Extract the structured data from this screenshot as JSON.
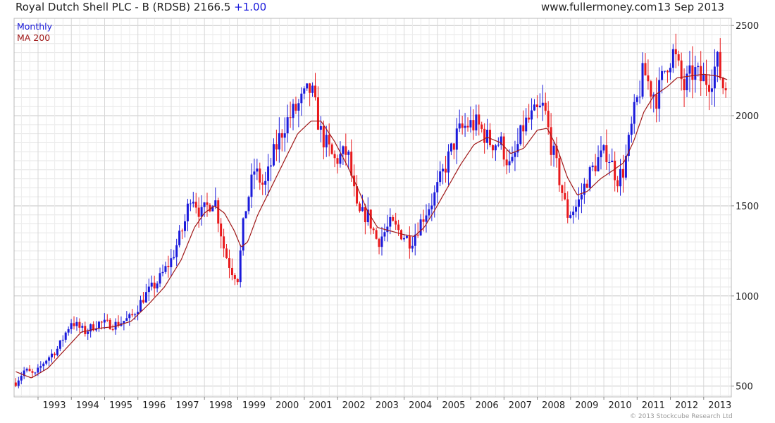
{
  "header": {
    "title": "Royal Dutch Shell PLC - B (RDSB) 2166.5",
    "change": "+1.00",
    "site": "www.fullermoney.com",
    "date": "13 Sep 2013"
  },
  "footer": {
    "copyright": "© 2013 Stockcube Research Ltd"
  },
  "colors": {
    "up": "#1a1adb",
    "down": "#e8191c",
    "ma": "#a01818",
    "grid": "#d4d4d4",
    "border": "#b9b9b9"
  },
  "chart_data": {
    "type": "candlestick",
    "legend": [
      {
        "label": "Monthly",
        "color": "#1a1adb"
      },
      {
        "label": "MA 200",
        "color": "#a01818"
      }
    ],
    "legend_position": "top-left",
    "y_axis_side": "right",
    "ylim": [
      440,
      2540
    ],
    "yticks": [
      500,
      1000,
      1500,
      2000,
      2500
    ],
    "xlim": [
      1992.28,
      2013.83
    ],
    "xticks": [
      {
        "label": "1993",
        "x": 1993.0
      },
      {
        "label": "1994",
        "x": 1994.0
      },
      {
        "label": "1995",
        "x": 1995.0
      },
      {
        "label": "1996",
        "x": 1996.0
      },
      {
        "label": "1997",
        "x": 1997.0
      },
      {
        "label": "1998",
        "x": 1998.0
      },
      {
        "label": "1999",
        "x": 1999.0
      },
      {
        "label": "2000",
        "x": 2000.0
      },
      {
        "label": "2001",
        "x": 2001.0
      },
      {
        "label": "2002",
        "x": 2002.0
      },
      {
        "label": "2003",
        "x": 2003.0
      },
      {
        "label": "2004",
        "x": 2004.0
      },
      {
        "label": "2005",
        "x": 2005.0
      },
      {
        "label": "2006",
        "x": 2006.0
      },
      {
        "label": "2007",
        "x": 2007.0
      },
      {
        "label": "2008",
        "x": 2008.0
      },
      {
        "label": "2009",
        "x": 2009.0
      },
      {
        "label": "2010",
        "x": 2010.0
      },
      {
        "label": "2011",
        "x": 2011.0
      },
      {
        "label": "2012",
        "x": 2012.0
      },
      {
        "label": "2013",
        "x": 2013.0
      }
    ],
    "grid": true,
    "price_anchors": [
      [
        1992.33,
        520
      ],
      [
        1992.6,
        590
      ],
      [
        1992.9,
        560
      ],
      [
        1993.2,
        640
      ],
      [
        1993.6,
        710
      ],
      [
        1994.0,
        860
      ],
      [
        1994.4,
        800
      ],
      [
        1994.8,
        850
      ],
      [
        1995.3,
        840
      ],
      [
        1995.8,
        880
      ],
      [
        1996.2,
        1000
      ],
      [
        1996.6,
        1080
      ],
      [
        1997.0,
        1200
      ],
      [
        1997.4,
        1400
      ],
      [
        1997.6,
        1580
      ],
      [
        1997.9,
        1450
      ],
      [
        1998.3,
        1550
      ],
      [
        1998.6,
        1250
      ],
      [
        1998.8,
        1150
      ],
      [
        1999.0,
        1100
      ],
      [
        1999.2,
        1450
      ],
      [
        1999.5,
        1700
      ],
      [
        1999.8,
        1600
      ],
      [
        2000.1,
        1800
      ],
      [
        2000.4,
        1950
      ],
      [
        2000.8,
        2050
      ],
      [
        2001.2,
        2150
      ],
      [
        2001.5,
        1900
      ],
      [
        2001.9,
        1750
      ],
      [
        2002.3,
        1800
      ],
      [
        2002.6,
        1450
      ],
      [
        2002.9,
        1450
      ],
      [
        2003.2,
        1300
      ],
      [
        2003.6,
        1400
      ],
      [
        2003.9,
        1350
      ],
      [
        2004.2,
        1300
      ],
      [
        2004.6,
        1450
      ],
      [
        2004.9,
        1550
      ],
      [
        2005.2,
        1700
      ],
      [
        2005.6,
        1900
      ],
      [
        2005.9,
        1950
      ],
      [
        2006.2,
        1950
      ],
      [
        2006.6,
        1850
      ],
      [
        2006.9,
        1850
      ],
      [
        2007.2,
        1700
      ],
      [
        2007.6,
        1950
      ],
      [
        2007.9,
        2000
      ],
      [
        2008.2,
        2050
      ],
      [
        2008.4,
        1850
      ],
      [
        2008.6,
        1700
      ],
      [
        2008.9,
        1450
      ],
      [
        2009.2,
        1500
      ],
      [
        2009.5,
        1650
      ],
      [
        2009.8,
        1750
      ],
      [
        2010.1,
        1800
      ],
      [
        2010.4,
        1650
      ],
      [
        2010.6,
        1700
      ],
      [
        2010.9,
        2000
      ],
      [
        2011.2,
        2250
      ],
      [
        2011.4,
        2150
      ],
      [
        2011.6,
        2100
      ],
      [
        2011.9,
        2300
      ],
      [
        2012.1,
        2350
      ],
      [
        2012.4,
        2150
      ],
      [
        2012.7,
        2250
      ],
      [
        2012.9,
        2200
      ],
      [
        2013.2,
        2200
      ],
      [
        2013.4,
        2300
      ],
      [
        2013.6,
        2150
      ],
      [
        2013.71,
        2166
      ]
    ],
    "ma_anchors": [
      [
        1992.33,
        580
      ],
      [
        1992.8,
        545
      ],
      [
        1993.3,
        600
      ],
      [
        1993.8,
        700
      ],
      [
        1994.3,
        800
      ],
      [
        1994.8,
        820
      ],
      [
        1995.3,
        830
      ],
      [
        1995.8,
        860
      ],
      [
        1996.3,
        950
      ],
      [
        1996.8,
        1050
      ],
      [
        1997.3,
        1200
      ],
      [
        1997.7,
        1380
      ],
      [
        1998.0,
        1460
      ],
      [
        1998.3,
        1500
      ],
      [
        1998.6,
        1460
      ],
      [
        1998.9,
        1360
      ],
      [
        1999.1,
        1270
      ],
      [
        1999.3,
        1300
      ],
      [
        1999.6,
        1450
      ],
      [
        2000.0,
        1600
      ],
      [
        2000.4,
        1750
      ],
      [
        2000.8,
        1900
      ],
      [
        2001.2,
        1970
      ],
      [
        2001.5,
        1970
      ],
      [
        2001.9,
        1860
      ],
      [
        2002.3,
        1720
      ],
      [
        2002.6,
        1600
      ],
      [
        2002.9,
        1470
      ],
      [
        2003.2,
        1380
      ],
      [
        2003.6,
        1360
      ],
      [
        2004.0,
        1340
      ],
      [
        2004.3,
        1330
      ],
      [
        2004.6,
        1380
      ],
      [
        2004.9,
        1470
      ],
      [
        2005.3,
        1600
      ],
      [
        2005.7,
        1730
      ],
      [
        2006.1,
        1840
      ],
      [
        2006.5,
        1880
      ],
      [
        2006.9,
        1850
      ],
      [
        2007.2,
        1790
      ],
      [
        2007.6,
        1820
      ],
      [
        2008.0,
        1920
      ],
      [
        2008.3,
        1930
      ],
      [
        2008.6,
        1820
      ],
      [
        2008.9,
        1660
      ],
      [
        2009.2,
        1560
      ],
      [
        2009.5,
        1580
      ],
      [
        2009.9,
        1650
      ],
      [
        2010.3,
        1700
      ],
      [
        2010.6,
        1740
      ],
      [
        2010.9,
        1860
      ],
      [
        2011.2,
        2020
      ],
      [
        2011.5,
        2110
      ],
      [
        2011.9,
        2160
      ],
      [
        2012.2,
        2210
      ],
      [
        2012.6,
        2220
      ],
      [
        2013.0,
        2230
      ],
      [
        2013.4,
        2220
      ],
      [
        2013.71,
        2200
      ]
    ]
  }
}
